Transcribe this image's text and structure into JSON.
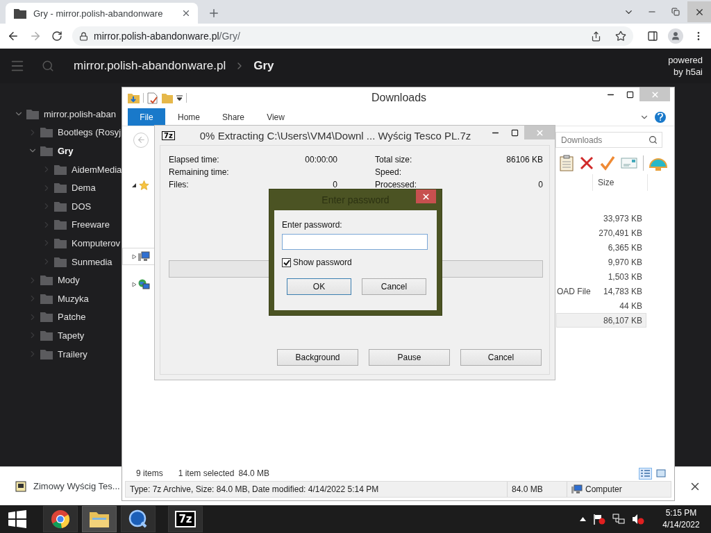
{
  "browser": {
    "tab": {
      "title": "Gry - mirror.polish-abandonware",
      "selected": true
    },
    "url_host": "mirror.polish-abandonware.pl",
    "url_path": "/Gry/"
  },
  "h5ai": {
    "crumbs": [
      {
        "label": "mirror.polish-abandonware.pl",
        "selected": false
      },
      {
        "label": "Gry",
        "selected": true
      }
    ],
    "powered_by": "powered by h5ai"
  },
  "tree": [
    {
      "label": "mirror.polish-aban",
      "expanded": true,
      "selected": false,
      "children": [
        {
          "label": "Bootlegs (Rosyj",
          "expanded": false,
          "selected": false
        },
        {
          "label": "Gry",
          "expanded": true,
          "selected": true,
          "children": [
            {
              "label": "AidemMedia",
              "expanded": false,
              "selected": false
            },
            {
              "label": "Dema",
              "expanded": false,
              "selected": false
            },
            {
              "label": "DOS",
              "expanded": false,
              "selected": false
            },
            {
              "label": "Freeware",
              "expanded": false,
              "selected": false
            },
            {
              "label": "Komputerov",
              "expanded": false,
              "selected": false
            },
            {
              "label": "Sunmedia",
              "expanded": false,
              "selected": false
            }
          ]
        },
        {
          "label": "Mody",
          "expanded": false,
          "selected": false
        },
        {
          "label": "Muzyka",
          "expanded": false,
          "selected": false
        },
        {
          "label": "Patche",
          "expanded": false,
          "selected": false
        },
        {
          "label": "Tapety",
          "expanded": false,
          "selected": false
        },
        {
          "label": "Trailery",
          "expanded": false,
          "selected": false
        }
      ]
    }
  ],
  "download_bar": {
    "filename": "Zimowy Wyścig Tes..."
  },
  "explorer": {
    "title": "Downloads",
    "ribbon_tabs": [
      {
        "label": "File",
        "selected": true
      },
      {
        "label": "Home",
        "selected": false
      },
      {
        "label": "Share",
        "selected": false
      },
      {
        "label": "View",
        "selected": false
      }
    ],
    "search_placeholder": "Downloads",
    "nav_pane": [
      {
        "kind": "favorites",
        "expanded": true,
        "selected": false
      },
      {
        "kind": "computer",
        "expanded": false,
        "selected": true
      },
      {
        "kind": "network",
        "expanded": false,
        "selected": false
      }
    ],
    "column_header": "Size",
    "rows": [
      {
        "size": "33,973 KB",
        "selected": false
      },
      {
        "size": "270,491 KB",
        "selected": false
      },
      {
        "size": "6,365 KB",
        "selected": false
      },
      {
        "size": "9,970 KB",
        "selected": false
      },
      {
        "size": "1,503 KB",
        "selected": false
      },
      {
        "type": "OAD File",
        "size": "14,783 KB",
        "selected": false
      },
      {
        "size": "44 KB",
        "selected": false
      },
      {
        "size": "86,107 KB",
        "selected": true
      }
    ],
    "status": {
      "count": "9 items",
      "selection": "1 item selected",
      "selection_size": "84.0 MB"
    },
    "details": {
      "info": "Type: 7z Archive, Size: 84.0 MB, Date modified: 4/14/2022 5:14 PM",
      "size": "84.0 MB",
      "location": "Computer"
    }
  },
  "extract": {
    "icon_text": "7z",
    "title": "0% Extracting C:\\Users\\VM4\\Downl ... Wyścig Tesco PL.7z",
    "stats": [
      {
        "label": "Elapsed time:",
        "value": "00:00:00"
      },
      {
        "label": "Total size:",
        "value": "86106 KB"
      },
      {
        "label": "Remaining time:"
      },
      {
        "label": "Speed:"
      },
      {
        "label": "Files:",
        "value": "0"
      },
      {
        "label": "Processed:",
        "value": "0"
      }
    ],
    "progress": {
      "level": 0
    },
    "buttons": [
      "Background",
      "Pause",
      "Cancel"
    ]
  },
  "password": {
    "title": "Enter password",
    "label": "Enter password:",
    "show_password": {
      "label": "Show password",
      "checked": true
    },
    "buttons": [
      {
        "label": "OK",
        "default": true
      },
      {
        "label": "Cancel",
        "default": false
      }
    ]
  },
  "taskbar": {
    "apps": [
      {
        "kind": "chrome",
        "active": false
      },
      {
        "kind": "explorer",
        "active": true
      },
      {
        "kind": "quicktime",
        "active": false
      },
      {
        "kind": "sevenzip",
        "label": "7z",
        "active": false
      }
    ],
    "time": "5:15 PM",
    "date": "4/14/2022"
  }
}
